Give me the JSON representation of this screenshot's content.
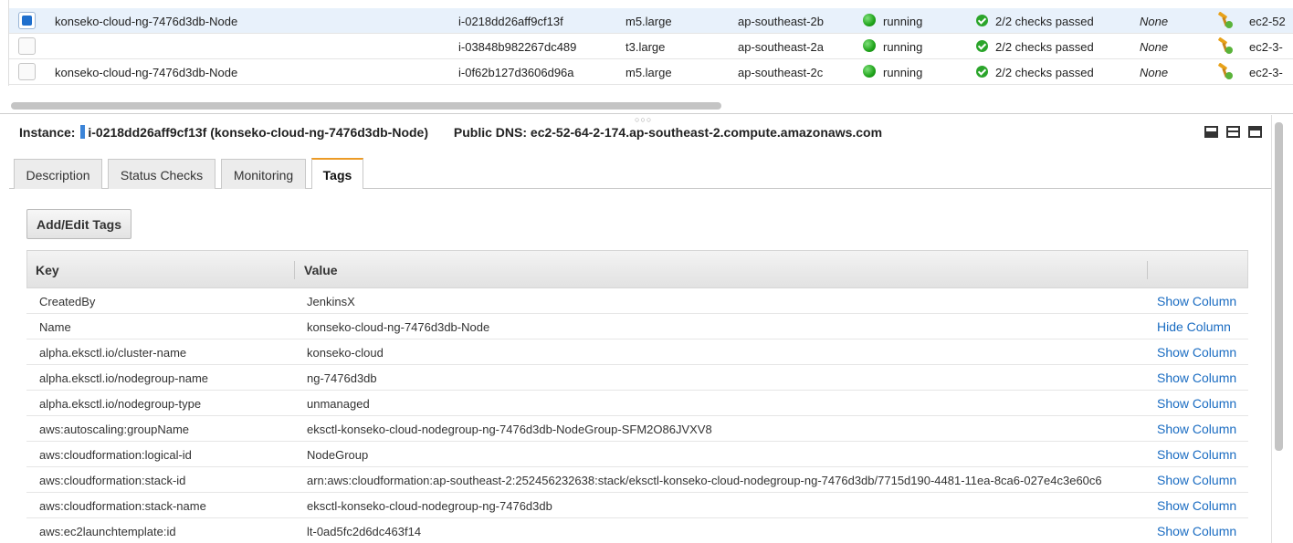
{
  "instances": [
    {
      "name": "konseko-cloud-ng-7476d3db-Node",
      "id": "i-0218dd26aff9cf13f",
      "type": "m5.large",
      "az": "ap-southeast-2b",
      "state": "running",
      "checks": "2/2 checks passed",
      "alarm": "None",
      "dns": "ec2-52",
      "selected": true
    },
    {
      "name": "",
      "id": "i-03848b982267dc489",
      "type": "t3.large",
      "az": "ap-southeast-2a",
      "state": "running",
      "checks": "2/2 checks passed",
      "alarm": "None",
      "dns": "ec2-3-",
      "selected": false
    },
    {
      "name": "konseko-cloud-ng-7476d3db-Node",
      "id": "i-0f62b127d3606d96a",
      "type": "m5.large",
      "az": "ap-southeast-2c",
      "state": "running",
      "checks": "2/2 checks passed",
      "alarm": "None",
      "dns": "ec2-3-",
      "selected": false
    }
  ],
  "detail": {
    "instance_label": "Instance:",
    "instance_value": "i-0218dd26aff9cf13f (konseko-cloud-ng-7476d3db-Node)",
    "dns_label": "Public DNS:",
    "dns_value": "ec2-52-64-2-174.ap-southeast-2.compute.amazonaws.com"
  },
  "tabs": [
    {
      "label": "Description"
    },
    {
      "label": "Status Checks"
    },
    {
      "label": "Monitoring"
    },
    {
      "label": "Tags",
      "active": true
    }
  ],
  "add_edit_tags_label": "Add/Edit Tags",
  "tag_table": {
    "headers": {
      "key": "Key",
      "value": "Value"
    },
    "rows": [
      {
        "key": "CreatedBy",
        "value": "JenkinsX",
        "action": "Show Column"
      },
      {
        "key": "Name",
        "value": "konseko-cloud-ng-7476d3db-Node",
        "action": "Hide Column"
      },
      {
        "key": "alpha.eksctl.io/cluster-name",
        "value": "konseko-cloud",
        "action": "Show Column"
      },
      {
        "key": "alpha.eksctl.io/nodegroup-name",
        "value": "ng-7476d3db",
        "action": "Show Column"
      },
      {
        "key": "alpha.eksctl.io/nodegroup-type",
        "value": "unmanaged",
        "action": "Show Column"
      },
      {
        "key": "aws:autoscaling:groupName",
        "value": "eksctl-konseko-cloud-nodegroup-ng-7476d3db-NodeGroup-SFM2O86JVXV8",
        "action": "Show Column"
      },
      {
        "key": "aws:cloudformation:logical-id",
        "value": "NodeGroup",
        "action": "Show Column"
      },
      {
        "key": "aws:cloudformation:stack-id",
        "value": "arn:aws:cloudformation:ap-southeast-2:252456232638:stack/eksctl-konseko-cloud-nodegroup-ng-7476d3db/7715d190-4481-11ea-8ca6-027e4c3e60c6",
        "action": "Show Column"
      },
      {
        "key": "aws:cloudformation:stack-name",
        "value": "eksctl-konseko-cloud-nodegroup-ng-7476d3db",
        "action": "Show Column"
      },
      {
        "key": "aws:ec2launchtemplate:id",
        "value": "lt-0ad5fc2d6dc463f14",
        "action": "Show Column"
      }
    ]
  },
  "colors": {
    "link": "#1a6cc2",
    "active_tab_accent": "#ec9b26",
    "selected_row": "#e8f1fb",
    "running": "#1fa31a"
  },
  "icons": [
    "checkbox-icon",
    "status-dot-icon",
    "checkmark-icon",
    "wrench-icon",
    "panel-layout-icon"
  ]
}
